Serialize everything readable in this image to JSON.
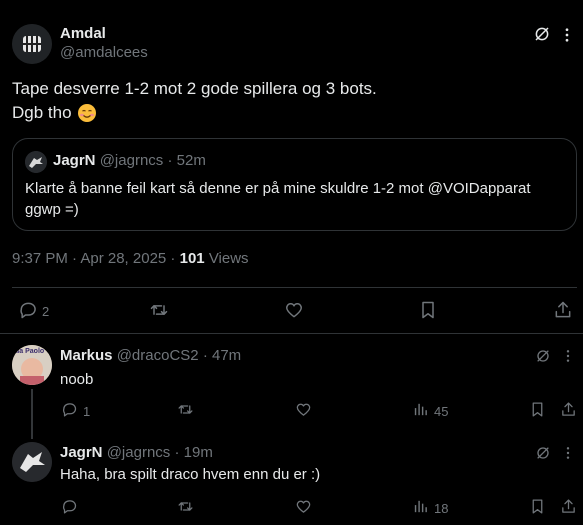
{
  "main_post": {
    "author_name": "Amdal",
    "author_handle": "@amdalcees",
    "text_line1": "Tape desverre 1-2 mot 2 gode spillera og 3 bots.",
    "text_line2": "Dgb tho",
    "emoji": "☺️",
    "quote": {
      "author_name": "JagrN",
      "author_handle": "@jagrncs",
      "separator": "·",
      "time": "52m",
      "text_line1": "Klarte å banne feil kart så denne er på mine skuldre 1-2 mot @VOIDapparat",
      "text_line2": "ggwp =)"
    },
    "meta_time": "9:37 PM · Apr 28, 2025 ·",
    "views_count": "101",
    "views_label": "Views",
    "actions": {
      "replies": "2"
    }
  },
  "replies": [
    {
      "author_name": "Markus",
      "author_handle": "@dracoCS2",
      "separator": "·",
      "time": "47m",
      "avatar_text": "da Paolo",
      "text": "noob",
      "reply_count": "1",
      "views": "45"
    },
    {
      "author_name": "JagrN",
      "author_handle": "@jagrncs",
      "separator": "·",
      "time": "19m",
      "text": "Haha, bra spilt draco hvem enn du er :)",
      "reply_count": "",
      "views": "18"
    }
  ],
  "icons": {
    "grok": "grok-icon",
    "reply": "reply-icon",
    "retweet": "retweet-icon",
    "like": "heart-icon",
    "bookmark": "bookmark-icon",
    "share": "share-icon",
    "views": "views-icon"
  },
  "colors": {
    "background": "#000000",
    "text": "#e7e9ea",
    "muted": "#71767b",
    "border": "#2f3336"
  }
}
